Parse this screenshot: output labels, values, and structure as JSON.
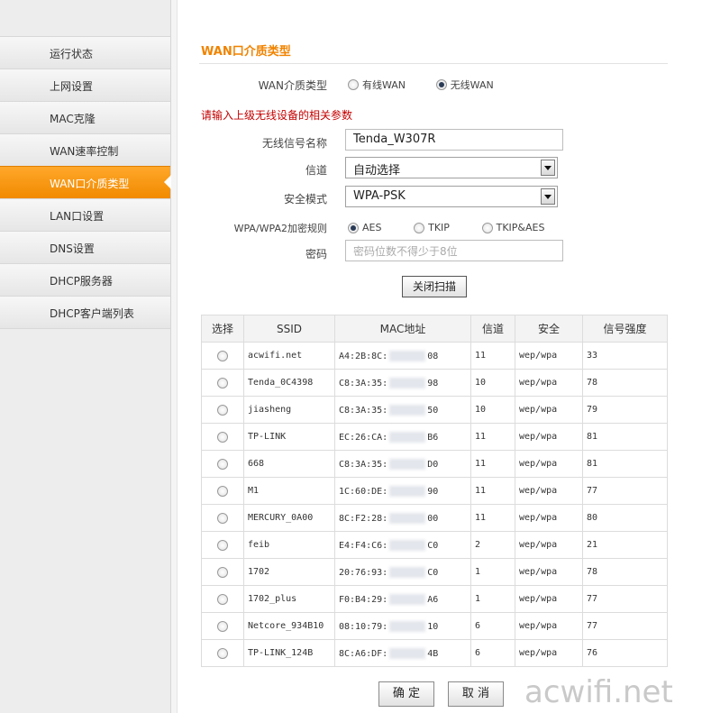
{
  "sidebar": {
    "items": [
      {
        "label": "运行状态",
        "active": false
      },
      {
        "label": "上网设置",
        "active": false
      },
      {
        "label": "MAC克隆",
        "active": false
      },
      {
        "label": "WAN速率控制",
        "active": false
      },
      {
        "label": "WAN口介质类型",
        "active": true
      },
      {
        "label": "LAN口设置",
        "active": false
      },
      {
        "label": "DNS设置",
        "active": false
      },
      {
        "label": "DHCP服务器",
        "active": false
      },
      {
        "label": "DHCP客户端列表",
        "active": false
      }
    ]
  },
  "main": {
    "title": "WAN口介质类型",
    "wan_type": {
      "label": "WAN介质类型",
      "options": [
        "有线WAN",
        "无线WAN"
      ],
      "selected": "无线WAN"
    },
    "notice": "请输入上级无线设备的相关参数",
    "ssid_field": {
      "label": "无线信号名称",
      "value": "Tenda_W307R"
    },
    "channel_field": {
      "label": "信道",
      "value": "自动选择"
    },
    "security_field": {
      "label": "安全模式",
      "value": "WPA-PSK"
    },
    "encryption": {
      "label": "WPA/WPA2加密规则",
      "options": [
        "AES",
        "TKIP",
        "TKIP&AES"
      ],
      "selected": "AES"
    },
    "password_field": {
      "label": "密码",
      "placeholder": "密码位数不得少于8位"
    },
    "scan_button": "关闭扫描",
    "table": {
      "headers": [
        "选择",
        "SSID",
        "MAC地址",
        "信道",
        "安全",
        "信号强度"
      ],
      "rows": [
        {
          "ssid": "acwifi.net",
          "mac_prefix": "A4:2B:8C:",
          "mac_suffix": "08",
          "channel": "11",
          "security": "wep/wpa",
          "signal": "33"
        },
        {
          "ssid": "Tenda_0C4398",
          "mac_prefix": "C8:3A:35:",
          "mac_suffix": "98",
          "channel": "10",
          "security": "wep/wpa",
          "signal": "78"
        },
        {
          "ssid": "jiasheng",
          "mac_prefix": "C8:3A:35:",
          "mac_suffix": "50",
          "channel": "10",
          "security": "wep/wpa",
          "signal": "79"
        },
        {
          "ssid": "TP-LINK",
          "mac_prefix": "EC:26:CA:",
          "mac_suffix": "B6",
          "channel": "11",
          "security": "wep/wpa",
          "signal": "81"
        },
        {
          "ssid": "668",
          "mac_prefix": "C8:3A:35:",
          "mac_suffix": "D0",
          "channel": "11",
          "security": "wep/wpa",
          "signal": "81"
        },
        {
          "ssid": "M1",
          "mac_prefix": "1C:60:DE:",
          "mac_suffix": "90",
          "channel": "11",
          "security": "wep/wpa",
          "signal": "77"
        },
        {
          "ssid": "MERCURY_0A00",
          "mac_prefix": "8C:F2:28:",
          "mac_suffix": "00",
          "channel": "11",
          "security": "wep/wpa",
          "signal": "80"
        },
        {
          "ssid": "feib",
          "mac_prefix": "E4:F4:C6:",
          "mac_suffix": "C0",
          "channel": "2",
          "security": "wep/wpa",
          "signal": "21"
        },
        {
          "ssid": "1702",
          "mac_prefix": "20:76:93:",
          "mac_suffix": "C0",
          "channel": "1",
          "security": "wep/wpa",
          "signal": "78"
        },
        {
          "ssid": "1702_plus",
          "mac_prefix": "F0:B4:29:",
          "mac_suffix": "A6",
          "channel": "1",
          "security": "wep/wpa",
          "signal": "77"
        },
        {
          "ssid": "Netcore_934B10",
          "mac_prefix": "08:10:79:",
          "mac_suffix": "10",
          "channel": "6",
          "security": "wep/wpa",
          "signal": "77"
        },
        {
          "ssid": "TP-LINK_124B",
          "mac_prefix": "8C:A6:DF:",
          "mac_suffix": "4B",
          "channel": "6",
          "security": "wep/wpa",
          "signal": "76"
        }
      ]
    },
    "ok_button": "确 定",
    "cancel_button": "取 消"
  },
  "watermark": "acwifi.net",
  "colors": {
    "accent": "#f08300",
    "notice": "#c40000",
    "active_nav": "#f39200"
  }
}
